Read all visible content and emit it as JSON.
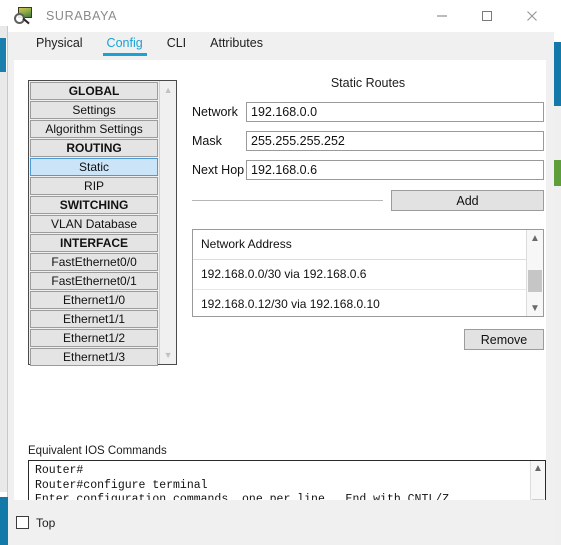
{
  "window": {
    "title": "SURABAYA",
    "icon": "packet-tracer-device-icon",
    "controls": {
      "minimize": "minimize-icon",
      "maximize": "maximize-icon",
      "close": "close-icon"
    }
  },
  "tabs": [
    {
      "label": "Physical",
      "active": false
    },
    {
      "label": "Config",
      "active": true
    },
    {
      "label": "CLI",
      "active": false
    },
    {
      "label": "Attributes",
      "active": false
    }
  ],
  "sidebar": {
    "items": [
      {
        "label": "GLOBAL",
        "type": "header"
      },
      {
        "label": "Settings",
        "type": "item"
      },
      {
        "label": "Algorithm Settings",
        "type": "item"
      },
      {
        "label": "ROUTING",
        "type": "header"
      },
      {
        "label": "Static",
        "type": "item",
        "selected": true
      },
      {
        "label": "RIP",
        "type": "item"
      },
      {
        "label": "SWITCHING",
        "type": "header"
      },
      {
        "label": "VLAN Database",
        "type": "item"
      },
      {
        "label": "INTERFACE",
        "type": "header"
      },
      {
        "label": "FastEthernet0/0",
        "type": "item"
      },
      {
        "label": "FastEthernet0/1",
        "type": "item"
      },
      {
        "label": "Ethernet1/0",
        "type": "item"
      },
      {
        "label": "Ethernet1/1",
        "type": "item"
      },
      {
        "label": "Ethernet1/2",
        "type": "item"
      },
      {
        "label": "Ethernet1/3",
        "type": "item"
      }
    ],
    "scroll_up": "▲",
    "scroll_down": "▼"
  },
  "static_routes": {
    "title": "Static Routes",
    "fields": [
      {
        "label": "Network",
        "value": "192.168.0.0"
      },
      {
        "label": "Mask",
        "value": "255.255.255.252"
      },
      {
        "label": "Next Hop",
        "value": "192.168.0.6"
      }
    ],
    "add_label": "Add",
    "remove_label": "Remove",
    "list_header": "Network Address",
    "list_rows": [
      "192.168.0.0/30 via 192.168.0.6",
      "192.168.0.12/30 via 192.168.0.10"
    ],
    "scroll_up": "▲",
    "scroll_down": "▼"
  },
  "ios": {
    "label": "Equivalent IOS Commands",
    "text": "Router#\nRouter#configure terminal\nEnter configuration commands, one per line.  End with CNTL/Z.\nRouter(config)#\nRouter(config)#",
    "scroll_up": "▲",
    "scroll_down": "▼"
  },
  "bottom": {
    "top_label": "Top",
    "top_checked": false
  },
  "colors": {
    "accent_blue": "#1ba1d6",
    "selection_blue": "#cce4f7",
    "backdrop_blue": "#1379a8",
    "backdrop_green": "#5d9e3a",
    "panel_gray": "#f0f0f0",
    "button_gray": "#e2e2e2"
  }
}
